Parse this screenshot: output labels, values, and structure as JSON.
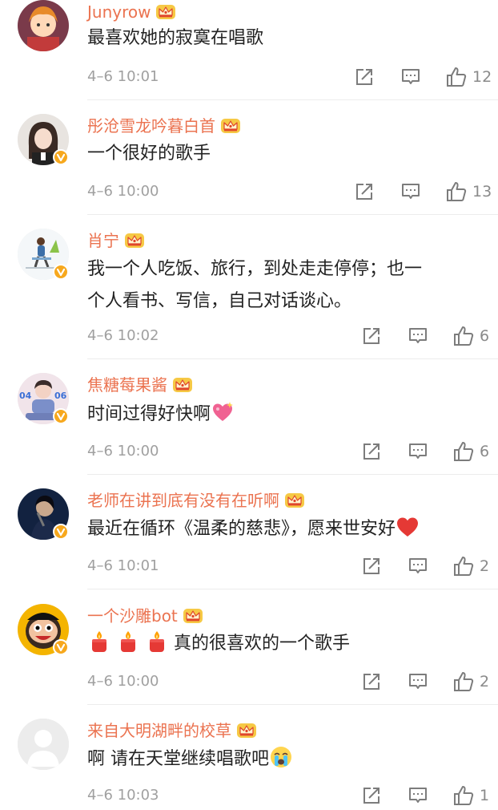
{
  "comments": [
    {
      "username": "Junyrow",
      "avatar": "anime-avatar",
      "verified": false,
      "lines": [
        "最喜欢她的寂寞在唱歌"
      ],
      "time": "4–6 10:01",
      "likes": "12"
    },
    {
      "username": "彤沧雪龙吟暮白首",
      "avatar": "girl-avatar",
      "verified": true,
      "lines": [
        "一个很好的歌手"
      ],
      "time": "4–6 10:00",
      "likes": "13"
    },
    {
      "username": "肖宁",
      "avatar": "illustration-avatar",
      "verified": true,
      "lines": [
        "我一个人吃饭、旅行，到处走走停停；也一",
        "个人看书、写信，自己对话谈心。"
      ],
      "time": "4–6 10:02",
      "likes": "6"
    },
    {
      "username": "焦糖莓果酱",
      "avatar": "star-photo-avatar",
      "verified": true,
      "avatar_text": [
        "04",
        "06"
      ],
      "lines": [
        "时间过得好快啊"
      ],
      "trailing_emoji": "sparkling-heart-emoji",
      "time": "4–6 10:00",
      "likes": "6"
    },
    {
      "username": "老师在讲到底有没有在听啊",
      "avatar": "singer-avatar",
      "verified": true,
      "lines": [
        "最近在循环《温柔的慈悲》，愿来世安好"
      ],
      "trailing_emoji": "red-heart-emoji",
      "time": "4–6 10:01",
      "likes": "2"
    },
    {
      "username": "一个沙雕bot",
      "avatar": "cartoon-avatar",
      "verified": true,
      "leading_emojis": [
        "candle-emoji",
        "candle-emoji",
        "candle-emoji"
      ],
      "lines": [
        "真的很喜欢的一个歌手"
      ],
      "time": "4–6 10:00",
      "likes": "2"
    },
    {
      "username": "来自大明湖畔的校草",
      "avatar": "default-avatar",
      "verified": false,
      "lines": [
        "啊 请在天堂继续唱歌吧"
      ],
      "trailing_emoji": "crying-face-emoji",
      "time": "4–6 10:03",
      "likes": "1"
    }
  ],
  "icons": {
    "badge": "crown-badge-icon",
    "repost": "repost-icon",
    "comment": "comment-icon",
    "like": "thumbs-up-icon",
    "verified": "verified-v-icon"
  },
  "colors": {
    "username": "#eb7350",
    "text": "#222222",
    "meta": "#a0a0a0",
    "verified": "#f7a81d",
    "divider": "#ececec"
  }
}
